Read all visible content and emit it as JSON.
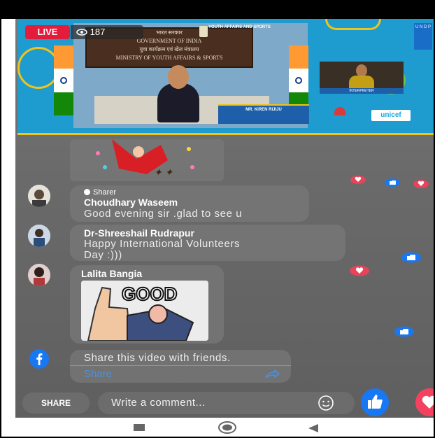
{
  "stream": {
    "live_label": "LIVE",
    "viewer_count": "187",
    "plaque_lines": [
      "भारत सरकार",
      "GOVERNMENT OF INDIA",
      "युवा कार्यक्रम एवं खेल मंत्रालय",
      "MINISTRY OF YOUTH AFFAIRS & SPORTS"
    ],
    "ministry_small": "YOUTH AFFAIRS AND SPORTS",
    "namecard_name": "MR. KIREN RIJIJU",
    "interpreter_label": "INTERPRETER",
    "undp_label": "U N D P",
    "unicef_label": "unicef",
    "colors": {
      "live": "#e41c3c",
      "video_bg": "#1e9cd0",
      "accent": "#f0c419"
    }
  },
  "comments": [
    {
      "badge": "Sharer",
      "name": "Choudhary Waseem",
      "text": "Good evening sir .glad to see u"
    },
    {
      "name": "Dr-Shreeshail Rudrapur",
      "text_line1": "Happy International Volunteers",
      "text_line2": "Day :)))"
    },
    {
      "name": "Lalita Bangia",
      "sticker_text": "GOOD"
    }
  ],
  "share_prompt": {
    "text": "Share this video with friends.",
    "action": "Share"
  },
  "bottom_bar": {
    "share_label": "SHARE",
    "comment_placeholder": "Write a comment..."
  },
  "icons": {
    "facebook": "facebook-icon",
    "like": "like-icon",
    "love": "love-icon",
    "emoji": "emoji-icon",
    "share_arrow": "share-arrow-icon"
  },
  "colors": {
    "facebook_blue": "#1877f2",
    "love_red": "#f3425f",
    "share_link": "#4a90e2"
  }
}
